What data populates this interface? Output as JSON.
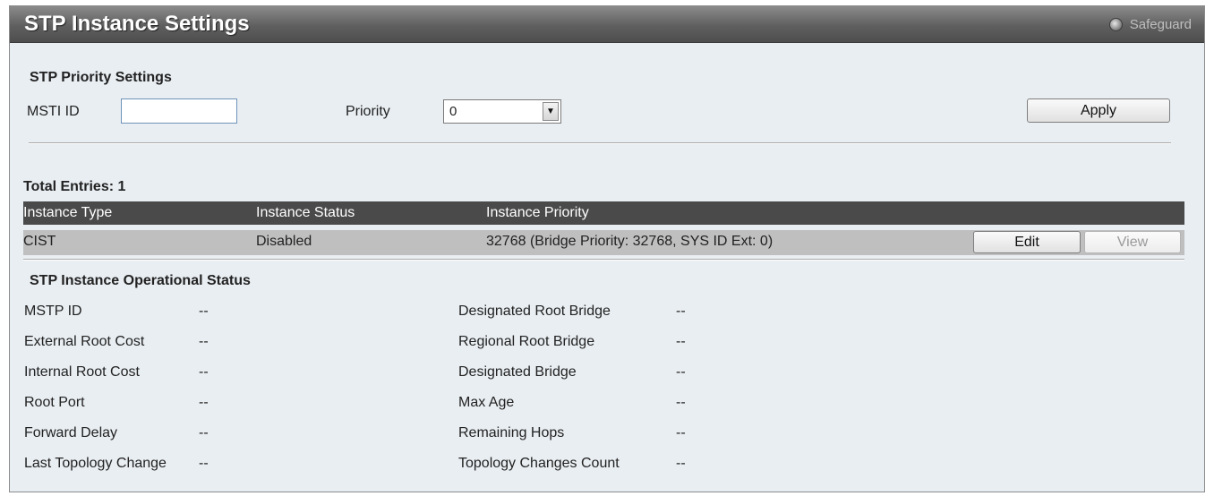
{
  "window": {
    "title": "STP Instance Settings",
    "safeguard_label": "Safeguard"
  },
  "priority_settings": {
    "heading": "STP Priority Settings",
    "msti_label": "MSTI ID",
    "msti_value": "",
    "priority_label": "Priority",
    "priority_value": "0",
    "apply_label": "Apply"
  },
  "table": {
    "total_entries": "Total Entries: 1",
    "headers": [
      "Instance Type",
      "Instance Status",
      "Instance Priority"
    ],
    "rows": [
      {
        "type": "CIST",
        "status": "Disabled",
        "priority": "32768 (Bridge Priority: 32768, SYS ID Ext: 0)",
        "edit_label": "Edit",
        "view_label": "View"
      }
    ]
  },
  "operational": {
    "heading": "STP Instance Operational Status",
    "left": [
      {
        "label": "MSTP ID",
        "value": "--"
      },
      {
        "label": "External Root Cost",
        "value": "--"
      },
      {
        "label": "Internal Root Cost",
        "value": "--"
      },
      {
        "label": "Root Port",
        "value": "--"
      },
      {
        "label": "Forward Delay",
        "value": "--"
      },
      {
        "label": "Last Topology Change",
        "value": "--"
      }
    ],
    "right": [
      {
        "label": "Designated Root Bridge",
        "value": "--"
      },
      {
        "label": "Regional Root Bridge",
        "value": "--"
      },
      {
        "label": "Designated Bridge",
        "value": "--"
      },
      {
        "label": "Max Age",
        "value": "--"
      },
      {
        "label": "Remaining Hops",
        "value": "--"
      },
      {
        "label": "Topology Changes Count",
        "value": "--"
      }
    ]
  }
}
